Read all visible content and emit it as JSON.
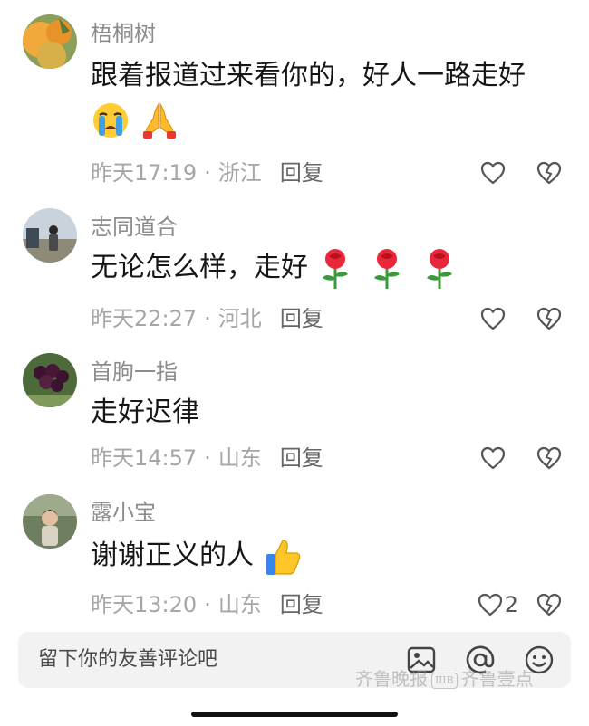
{
  "comments": [
    {
      "username": "梧桐树",
      "text": "跟着报道过来看你的，好人一路走好",
      "time": "昨天17:19",
      "location": "浙江",
      "reply_label": "回复",
      "like_count": "",
      "emojis": [
        "crying-face",
        "folded-hands"
      ],
      "avatar": "orange-fruit"
    },
    {
      "username": "志同道合",
      "text": "无论怎么样，走好",
      "time": "昨天22:27",
      "location": "河北",
      "reply_label": "回复",
      "like_count": "",
      "emojis": [
        "rose",
        "rose",
        "rose"
      ],
      "avatar": "person-field"
    },
    {
      "username": "首朐一指",
      "text": "走好迟律",
      "time": "昨天14:57",
      "location": "山东",
      "reply_label": "回复",
      "like_count": "",
      "emojis": [],
      "avatar": "grapes"
    },
    {
      "username": "露小宝",
      "text": "谢谢正义的人",
      "time": "昨天13:20",
      "location": "山东",
      "reply_label": "回复",
      "like_count": "2",
      "emojis": [
        "thumbs-up"
      ],
      "avatar": "person-outdoor"
    }
  ],
  "separator": "·",
  "input": {
    "placeholder": "留下你的友善评论吧",
    "icons": [
      "image-icon",
      "at-icon",
      "emoji-icon"
    ]
  },
  "watermark": {
    "brand_script": "齐鲁晚报",
    "badge": "ШB",
    "brand_text": "齐鲁壹点"
  },
  "colors": {
    "username": "#8c8c8c",
    "text": "#161616",
    "meta": "#a6a6a6",
    "input_bg": "#f2f2f2"
  }
}
